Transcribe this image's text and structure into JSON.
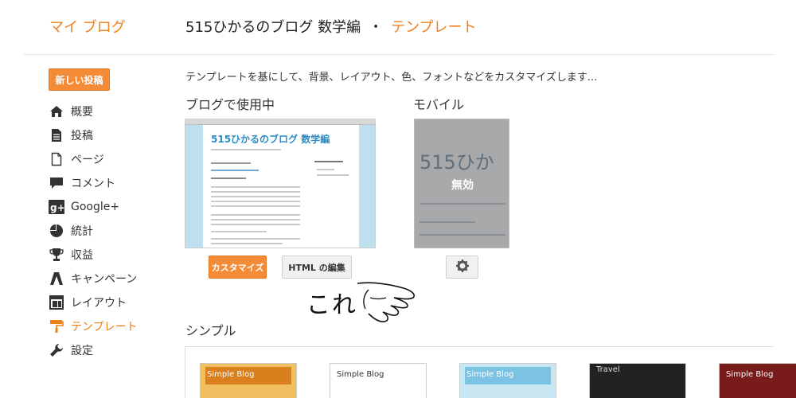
{
  "header": {
    "brand": "マイ ブログ",
    "blog_name": "515ひかるのブログ 数学編",
    "separator": "・",
    "section": "テンプレート"
  },
  "new_post_label": "新しい投稿",
  "nav": [
    {
      "label": "概要",
      "icon": "home-icon"
    },
    {
      "label": "投稿",
      "icon": "posts-icon"
    },
    {
      "label": "ページ",
      "icon": "pages-icon"
    },
    {
      "label": "コメント",
      "icon": "comment-icon"
    },
    {
      "label": "Google+",
      "icon": "google-plus-icon"
    },
    {
      "label": "統計",
      "icon": "stats-pie-icon"
    },
    {
      "label": "収益",
      "icon": "trophy-icon"
    },
    {
      "label": "キャンペーン",
      "icon": "campaign-icon"
    },
    {
      "label": "レイアウト",
      "icon": "layout-icon"
    },
    {
      "label": "テンプレート",
      "icon": "template-paint-roller-icon",
      "active": true
    },
    {
      "label": "設定",
      "icon": "wrench-icon"
    }
  ],
  "main": {
    "intro": "テンプレートを基にして、背景、レイアウト、色、フォントなどをカスタマイズします...",
    "in_use_heading": "ブログで使用中",
    "mobile_heading": "モバイル",
    "desktop_preview_title": "515ひかるのブログ 数学編",
    "mobile_preview_title": "515ひか",
    "mobile_status": "無効",
    "customize_label": "カスタマイズ",
    "edit_html_label": "HTML の編集",
    "annotation": "これ",
    "simple_heading": "シンプル",
    "template_names": [
      "Simple Blog",
      "Simple Blog",
      "Simple Blog",
      "Travel",
      "Simple Blog"
    ]
  },
  "colors": {
    "accent": "#ef7f1a",
    "button_orange": "#f48b36",
    "link_blue": "#2a8cc5"
  }
}
